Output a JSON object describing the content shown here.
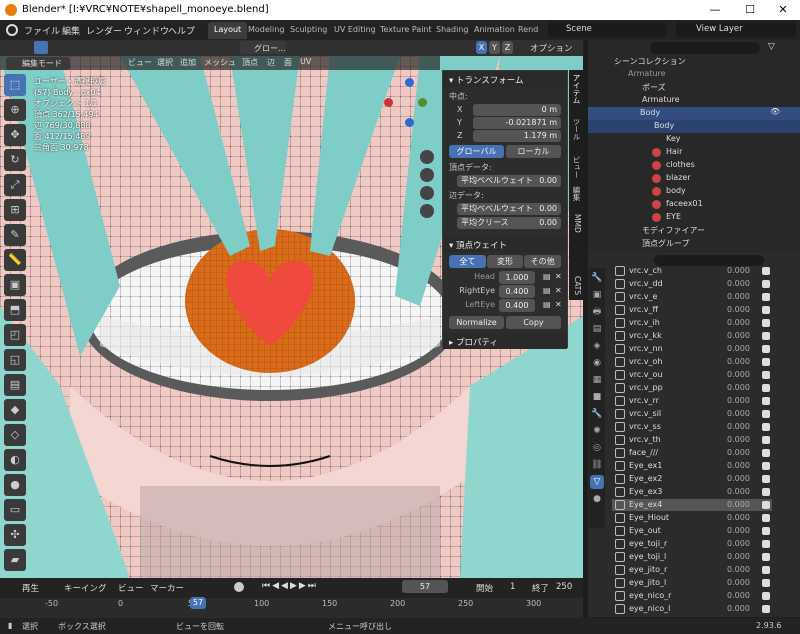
{
  "window": {
    "title": "Blender* [I:¥VRC¥NOTE¥shapell_monoeye.blend]",
    "min": "—",
    "max": "☐",
    "close": "✕"
  },
  "menu": [
    "ファイル",
    "編集",
    "レンダー",
    "ウィンドウ",
    "ヘルプ"
  ],
  "workspaces": [
    "Layout",
    "Modeling",
    "Sculpting",
    "UV Editing",
    "Texture Paint",
    "Shading",
    "Animation",
    "Rend"
  ],
  "scene": {
    "label": "Scene",
    "view_layer": "View Layer"
  },
  "toolbar": {
    "transform": "グロー...",
    "options": "オプション",
    "axes": [
      "X",
      "Y",
      "Z"
    ]
  },
  "viewport": {
    "mode": "編集モード",
    "menus": [
      "ビュー",
      "選択",
      "追加",
      "メッシュ",
      "頂点",
      "辺",
      "面",
      "UV"
    ],
    "overlay_lines": [
      "ユーザー・透視投影",
      "(57) Body : ox04",
      "オブジェクト 1/1",
      "頂点 362/15,494",
      "辺 769/30,888",
      "面 412/15,489",
      "三角面 30,978"
    ]
  },
  "npanel": {
    "transform_header": "トランスフォーム",
    "median": "中点:",
    "coords": [
      {
        "axis": "X",
        "value": "0 m"
      },
      {
        "axis": "Y",
        "value": "-0.021871 m"
      },
      {
        "axis": "Z",
        "value": "1.179 m"
      }
    ],
    "global": "グローバル",
    "local": "ローカル",
    "vertex_data": "頂点データ:",
    "bevel_weight": "平均ベベルウェイト",
    "bevel_weight_val": "0.00",
    "edge_data": "辺データ:",
    "edge_bevel": "平均ベベルウェイト",
    "edge_bevel_val": "0.00",
    "crease": "平均クリース",
    "crease_val": "0.00",
    "vw_header": "頂点ウェイト",
    "tabs": [
      "全て",
      "変形",
      "その他"
    ],
    "weights": [
      {
        "name": "Head",
        "value": "1.000"
      },
      {
        "name": "RightEye",
        "value": "0.400"
      },
      {
        "name": "LeftEye",
        "value": "0.400"
      }
    ],
    "normalize": "Normalize",
    "copy": "Copy",
    "props_header": "プロパティ"
  },
  "sidetabs": [
    "アイテム",
    "ツール",
    "ビュー",
    "編集",
    "MMD",
    "CATS"
  ],
  "outliner": {
    "search": "",
    "items": [
      {
        "label": "シーンコレクション"
      },
      {
        "label": "Armature"
      },
      {
        "label": "ポーズ"
      },
      {
        "label": "Armature"
      },
      {
        "label": "Body"
      },
      {
        "label": "Body"
      },
      {
        "label": "Key"
      },
      {
        "label": "Hair"
      },
      {
        "label": "clothes"
      },
      {
        "label": "blazer"
      },
      {
        "label": "body"
      },
      {
        "label": "faceex01"
      },
      {
        "label": "EYE"
      },
      {
        "label": "モディファイアー"
      },
      {
        "label": "頂点グループ"
      }
    ]
  },
  "shapekeys": [
    {
      "name": "vrc.v_ch",
      "value": "0.000"
    },
    {
      "name": "vrc.v_dd",
      "value": "0.000"
    },
    {
      "name": "vrc.v_e",
      "value": "0.000"
    },
    {
      "name": "vrc.v_ff",
      "value": "0.000"
    },
    {
      "name": "vrc.v_ih",
      "value": "0.000"
    },
    {
      "name": "vrc.v_kk",
      "value": "0.000"
    },
    {
      "name": "vrc.v_nn",
      "value": "0.000"
    },
    {
      "name": "vrc.v_oh",
      "value": "0.000"
    },
    {
      "name": "vrc.v_ou",
      "value": "0.000"
    },
    {
      "name": "vrc.v_pp",
      "value": "0.000"
    },
    {
      "name": "vrc.v_rr",
      "value": "0.000"
    },
    {
      "name": "vrc.v_sil",
      "value": "0.000"
    },
    {
      "name": "vrc.v_ss",
      "value": "0.000"
    },
    {
      "name": "vrc.v_th",
      "value": "0.000"
    },
    {
      "name": "face_///",
      "value": "0.000"
    },
    {
      "name": "Eye_ex1",
      "value": "0.000"
    },
    {
      "name": "Eye_ex2",
      "value": "0.000"
    },
    {
      "name": "Eye_ex3",
      "value": "0.000"
    },
    {
      "name": "Eye_ex4",
      "value": "0.000"
    },
    {
      "name": "Eye_Hiout",
      "value": "0.000"
    },
    {
      "name": "Eye_out",
      "value": "0.000"
    },
    {
      "name": "eye_toji_r",
      "value": "0.000"
    },
    {
      "name": "eye_toji_l",
      "value": "0.000"
    },
    {
      "name": "eye_jito_r",
      "value": "0.000"
    },
    {
      "name": "eye_jito_l",
      "value": "0.000"
    },
    {
      "name": "eye_nico_r",
      "value": "0.000"
    },
    {
      "name": "eye_nico_l",
      "value": "0.000"
    }
  ],
  "timeline": {
    "playback": "再生",
    "keying": "キーイング",
    "view": "ビュー",
    "marker": "マーカー",
    "frame": "57",
    "start_label": "開始",
    "start": "1",
    "end_label": "終了",
    "end": "250",
    "ticks": [
      "-50",
      "0",
      "50",
      "100",
      "150",
      "200",
      "250",
      "300"
    ],
    "current": "57"
  },
  "status": {
    "select": "選択",
    "box": "ボックス選択",
    "rotate": "ビューを回転",
    "menu": "メニュー呼び出し",
    "version": "2.93.6"
  },
  "colors": {
    "accent": "#4772b3",
    "selected_row": "#334d80"
  }
}
